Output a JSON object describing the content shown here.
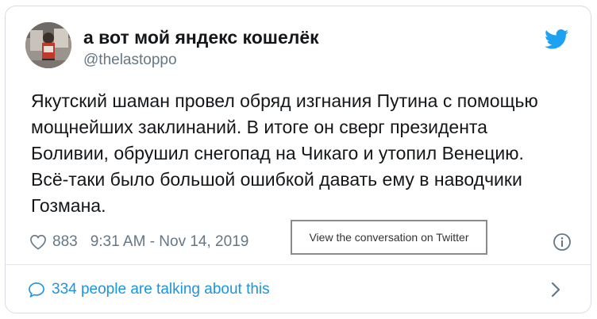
{
  "author": {
    "display_name": "а вот мой яндекс кошелёк",
    "handle": "@thelastoppo"
  },
  "tweet": {
    "lines": [
      "Якутский шаман провел обряд изгнания Путина с помощью",
      "мощнейших заклинаний. В итоге он сверг президента",
      "Боливии, обрушил снегопад на Чикаго и утопил Венецию.",
      "Всё-таки было большой ошибкой давать ему в наводчики",
      "Гозмана."
    ],
    "likes": "883",
    "timestamp": "9:31 AM - Nov 14, 2019"
  },
  "conversation_link": "View the conversation on Twitter",
  "talking": "334 people are talking about this",
  "icons": {
    "like": "heart-icon",
    "info": "info-icon",
    "brand": "twitter-bird-icon",
    "reply": "speech-bubble-icon",
    "more": "chevron-right-icon"
  },
  "colors": {
    "brand_blue": "#1da1f2",
    "link_blue": "#1b95e0",
    "secondary_text": "#657786",
    "primary_text": "#14171a"
  }
}
